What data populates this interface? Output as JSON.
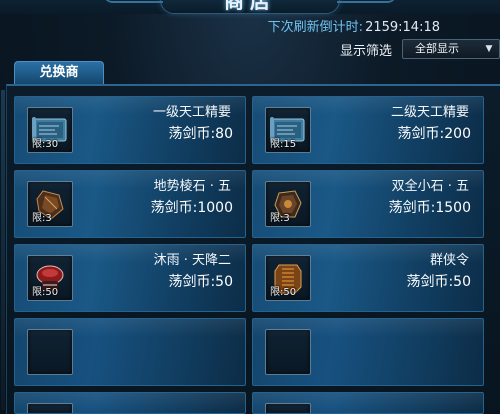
{
  "header": {
    "title": "商店",
    "refresh_label": "下次刷新倒计时:",
    "refresh_value": "2159:14:18"
  },
  "filter": {
    "label": "显示筛选",
    "selected": "全部显示"
  },
  "tab": {
    "label": "兑换商"
  },
  "items": [
    {
      "name": "一级天工精要",
      "price": "荡剑币:80",
      "limit": "限:30",
      "icon": "scroll-icon"
    },
    {
      "name": "二级天工精要",
      "price": "荡剑币:200",
      "limit": "限:15",
      "icon": "scroll-icon"
    },
    {
      "name": "地势棱石 · 五",
      "price": "荡剑币:1000",
      "limit": "限:3",
      "icon": "stone-icon"
    },
    {
      "name": "双全小石 · 五",
      "price": "荡剑币:1500",
      "limit": "限:3",
      "icon": "stone-icon"
    },
    {
      "name": "沐雨 · 天降二",
      "price": "荡剑币:50",
      "limit": "限:50",
      "icon": "rain-charm-icon"
    },
    {
      "name": "群侠令",
      "price": "荡剑币:50",
      "limit": "限:50",
      "icon": "token-icon"
    }
  ]
}
